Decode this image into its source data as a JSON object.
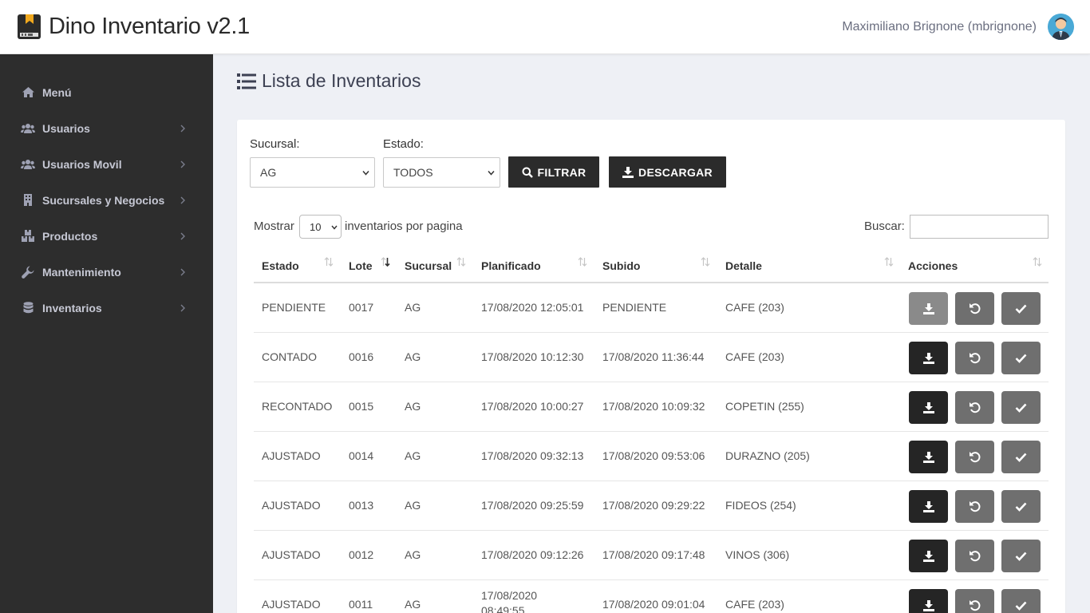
{
  "app": {
    "title": "Dino Inventario v2.1",
    "user": "Maximiliano Brignone (mbrignone)"
  },
  "sidebar": {
    "items": [
      {
        "label": "Menú",
        "icon": "home-icon",
        "has_children": false
      },
      {
        "label": "Usuarios",
        "icon": "users-icon",
        "has_children": true
      },
      {
        "label": "Usuarios Movil",
        "icon": "users-icon",
        "has_children": true
      },
      {
        "label": "Sucursales y Negocios",
        "icon": "building-icon",
        "has_children": true
      },
      {
        "label": "Productos",
        "icon": "boxes-icon",
        "has_children": true
      },
      {
        "label": "Mantenimiento",
        "icon": "wrench-icon",
        "has_children": true
      },
      {
        "label": "Inventarios",
        "icon": "database-icon",
        "has_children": true
      }
    ]
  },
  "page": {
    "title": "Lista de Inventarios"
  },
  "filters": {
    "sucursal_label": "Sucursal:",
    "sucursal_value": "AG",
    "estado_label": "Estado:",
    "estado_value": "TODOS",
    "filtrar_label": "FILTRAR",
    "descargar_label": "DESCARGAR"
  },
  "table_controls": {
    "mostrar_label": "Mostrar",
    "page_size": "10",
    "per_page_label": "inventarios por pagina",
    "buscar_label": "Buscar:"
  },
  "table": {
    "columns": [
      "Estado",
      "Lote",
      "Sucursal",
      "Planificado",
      "Subido",
      "Detalle",
      "Acciones"
    ],
    "rows": [
      {
        "estado": "PENDIENTE",
        "lote": "0017",
        "sucursal": "AG",
        "planificado": "17/08/2020 12:05:01",
        "subido": "PENDIENTE",
        "detalle": "CAFE (203)",
        "download_enabled": false
      },
      {
        "estado": "CONTADO",
        "lote": "0016",
        "sucursal": "AG",
        "planificado": "17/08/2020 10:12:30",
        "subido": "17/08/2020 11:36:44",
        "detalle": "CAFE (203)",
        "download_enabled": true
      },
      {
        "estado": "RECONTADO",
        "lote": "0015",
        "sucursal": "AG",
        "planificado": "17/08/2020 10:00:27",
        "subido": "17/08/2020 10:09:32",
        "detalle": "COPETIN (255)",
        "download_enabled": true
      },
      {
        "estado": "AJUSTADO",
        "lote": "0014",
        "sucursal": "AG",
        "planificado": "17/08/2020 09:32:13",
        "subido": "17/08/2020 09:53:06",
        "detalle": "DURAZNO (205)",
        "download_enabled": true
      },
      {
        "estado": "AJUSTADO",
        "lote": "0013",
        "sucursal": "AG",
        "planificado": "17/08/2020 09:25:59",
        "subido": "17/08/2020 09:29:22",
        "detalle": "FIDEOS (254)",
        "download_enabled": true
      },
      {
        "estado": "AJUSTADO",
        "lote": "0012",
        "sucursal": "AG",
        "planificado": "17/08/2020 09:12:26",
        "subido": "17/08/2020 09:17:48",
        "detalle": "VINOS (306)",
        "download_enabled": true
      },
      {
        "estado": "AJUSTADO",
        "lote": "0011",
        "sucursal": "AG",
        "planificado": "17/08/2020 08:49:55",
        "subido": "17/08/2020 09:01:04",
        "detalle": "CAFE (203)",
        "download_enabled": true
      }
    ]
  },
  "colors": {
    "sidebar_bg": "#2d2d2d",
    "button_dark": "#2b2b2b",
    "action_gray": "#6f6f6f",
    "page_bg": "#eef0f5"
  }
}
